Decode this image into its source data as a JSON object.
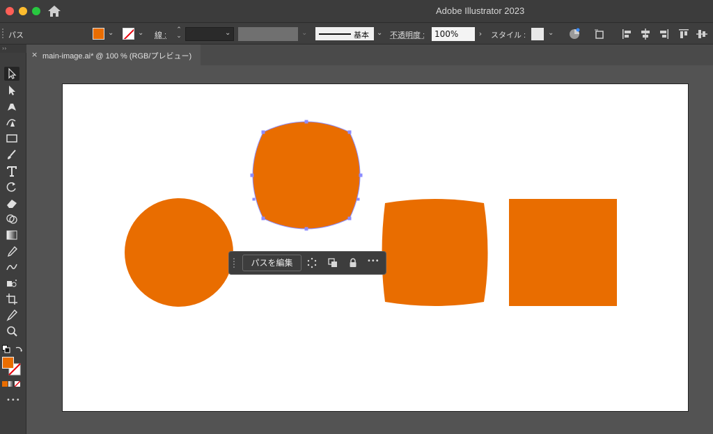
{
  "window": {
    "title": "Adobe Illustrator 2023"
  },
  "control_bar": {
    "selection_type": "パス",
    "stroke_label": "線 :",
    "stroke_profile_label": "基本",
    "opacity_label": "不透明度 :",
    "opacity_value": "100%",
    "style_label": "スタイル :"
  },
  "document_tab": {
    "close": "×",
    "title": "main-image.ai* @ 100 % (RGB/プレビュー)"
  },
  "context_bar": {
    "edit_path_label": "パスを編集",
    "more": "•••"
  },
  "toolbar": {
    "more": "•••"
  },
  "colors": {
    "fill": "#e96d00",
    "stroke": "none",
    "selection_outline": "#8c8cff",
    "artboard": "#ffffff",
    "ui_dark": "#3e3e3e"
  },
  "artwork": [
    {
      "shape": "circle",
      "fill": "#e96d00"
    },
    {
      "shape": "rounded-squircle",
      "fill": "#e96d00",
      "selected": true
    },
    {
      "shape": "bulged-square",
      "fill": "#e96d00"
    },
    {
      "shape": "square",
      "fill": "#e96d00"
    }
  ]
}
